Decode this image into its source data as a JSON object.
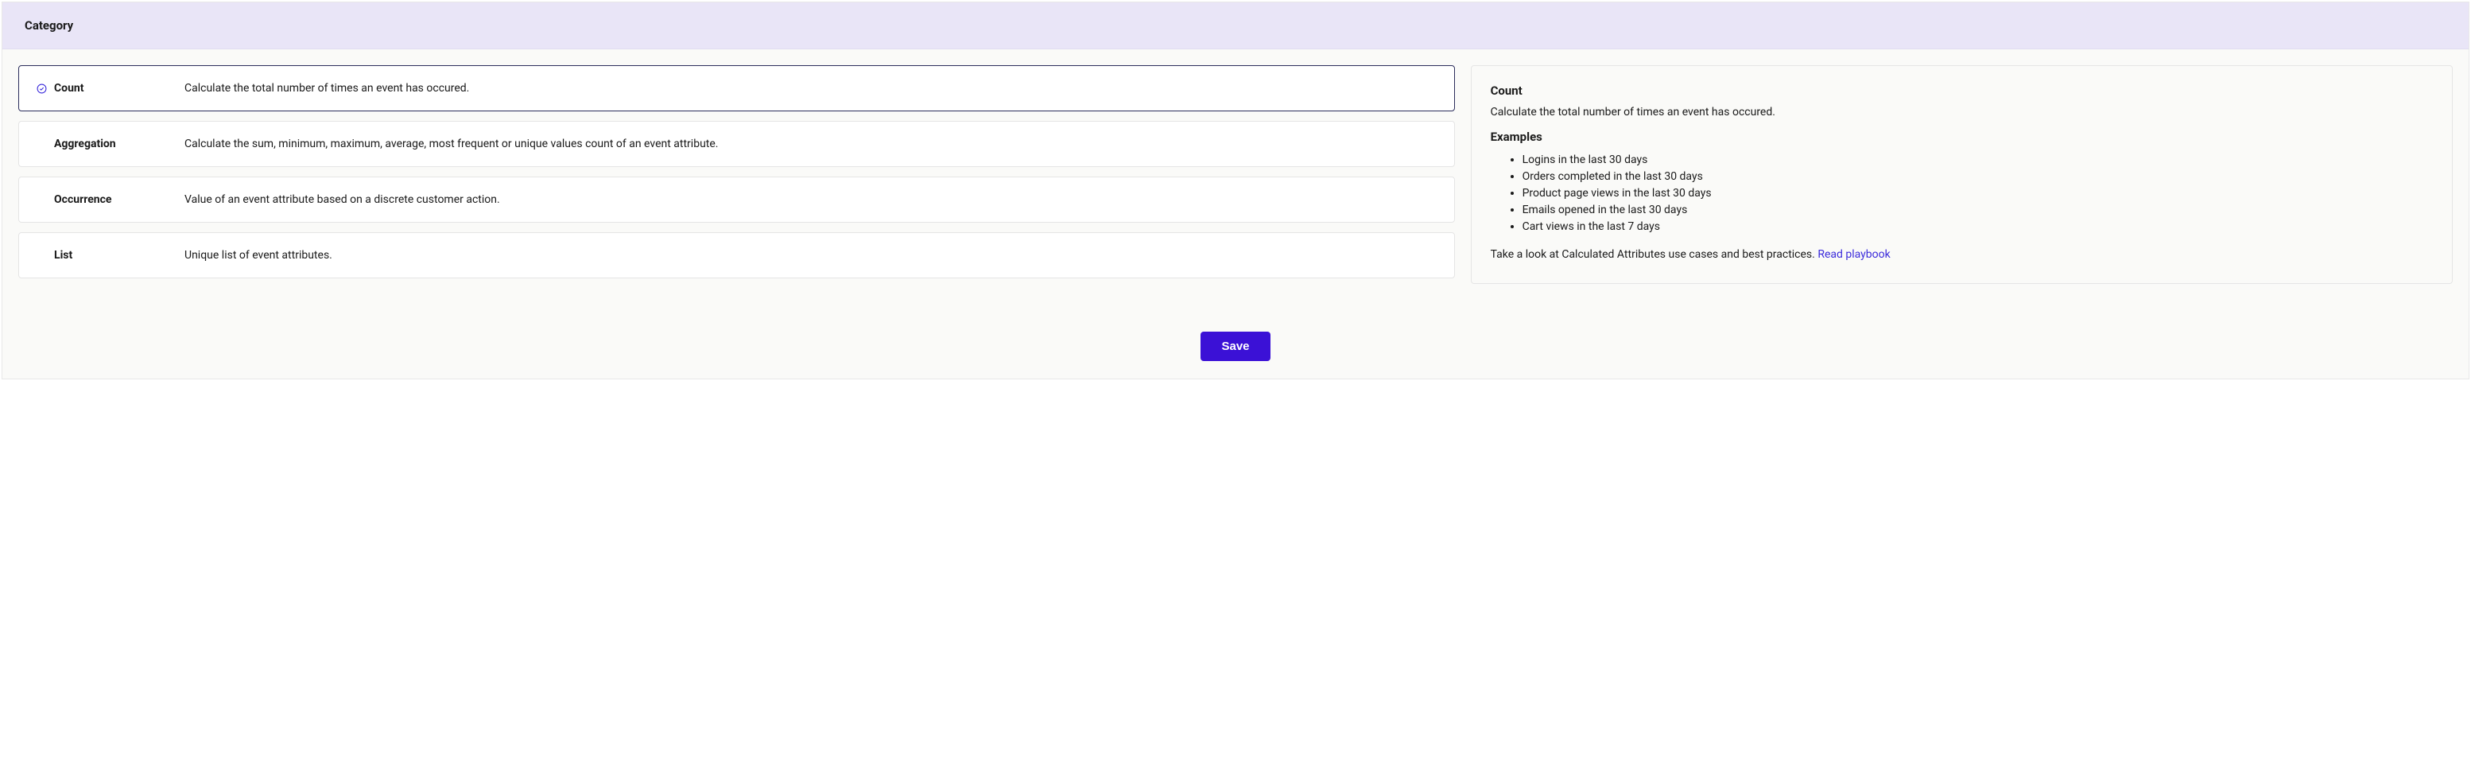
{
  "header": {
    "title": "Category"
  },
  "options": [
    {
      "name": "Count",
      "description": "Calculate the total number of times an event has occured.",
      "selected": true
    },
    {
      "name": "Aggregation",
      "description": "Calculate the sum, minimum, maximum, average, most frequent or unique values count of an event attribute.",
      "selected": false
    },
    {
      "name": "Occurrence",
      "description": "Value of an event attribute based on a discrete customer action.",
      "selected": false
    },
    {
      "name": "List",
      "description": "Unique list of event attributes.",
      "selected": false
    }
  ],
  "detail": {
    "title": "Count",
    "description": "Calculate the total number of times an event has occured.",
    "examples_heading": "Examples",
    "examples": [
      "Logins in the last 30 days",
      "Orders completed in the last 30 days",
      "Product page views in the last 30 days",
      "Emails opened in the last 30 days",
      "Cart views in the last 7 days"
    ],
    "playbook_text": "Take a look at Calculated Attributes use cases and best practices. ",
    "playbook_link_text": "Read playbook"
  },
  "footer": {
    "save_label": "Save"
  }
}
